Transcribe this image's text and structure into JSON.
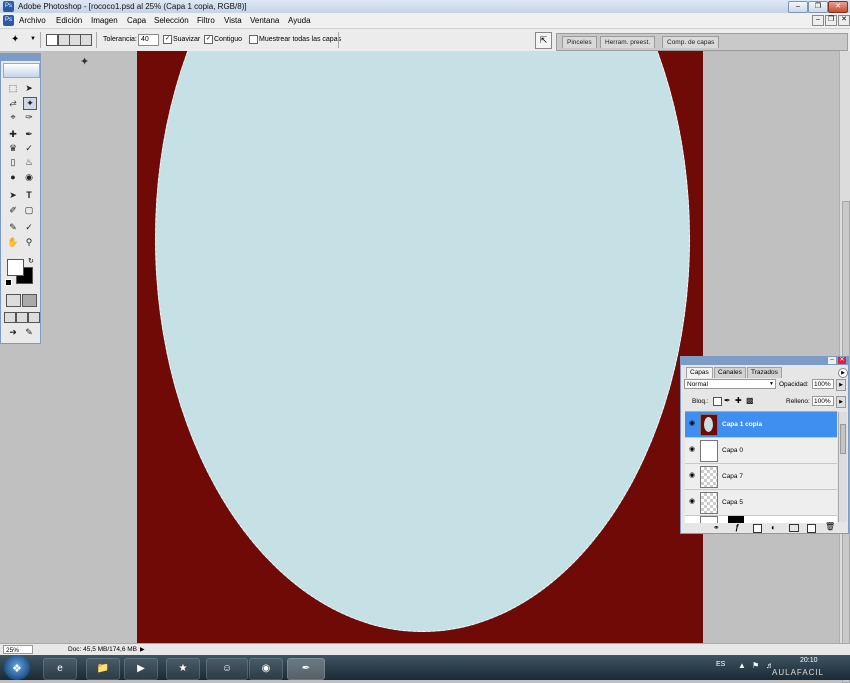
{
  "window": {
    "title": "Adobe Photoshop - [rococo1.psd al 25% (Capa 1 copia, RGB/8)]",
    "controls": [
      "minimize",
      "restore",
      "close"
    ]
  },
  "menu": [
    "Archivo",
    "Edición",
    "Imagen",
    "Capa",
    "Selección",
    "Filtro",
    "Vista",
    "Ventana",
    "Ayuda"
  ],
  "options": {
    "tolerance_label": "Tolerancia:",
    "tolerance_value": "40",
    "antialias_label": "Suavizar",
    "antialias_checked": true,
    "contiguous_label": "Contiguo",
    "contiguous_checked": true,
    "all_layers_label": "Muestrear todas las capas",
    "all_layers_checked": false
  },
  "well_tabs": [
    "Pinceles",
    "Herram. preest.",
    "Comp. de capas"
  ],
  "canvas": {
    "background_color": "#6f0a07",
    "selection_fill": "#c5e1e6"
  },
  "status": {
    "zoom": "25%",
    "doc": "Doc: 45,5 MB/174,6 MB"
  },
  "layers_panel": {
    "tabs": [
      "Capas",
      "Canales",
      "Trazados"
    ],
    "blend_mode": "Normal",
    "opacity_label": "Opacidad:",
    "opacity_value": "100%",
    "lock_label": "Bloq.:",
    "fill_label": "Relleno:",
    "fill_value": "100%",
    "layers": [
      {
        "name": "Capa 1 copia",
        "selected": true
      },
      {
        "name": "Capa 0",
        "selected": false
      },
      {
        "name": "Capa 7",
        "selected": false
      },
      {
        "name": "Capa 5",
        "selected": false
      }
    ]
  },
  "taskbar": {
    "language": "ES",
    "time": "20:10",
    "watermark": "AULAFACIL"
  },
  "colors": {
    "accent": "#3e8ff0",
    "toolbox_border": "#7a9cc6"
  }
}
